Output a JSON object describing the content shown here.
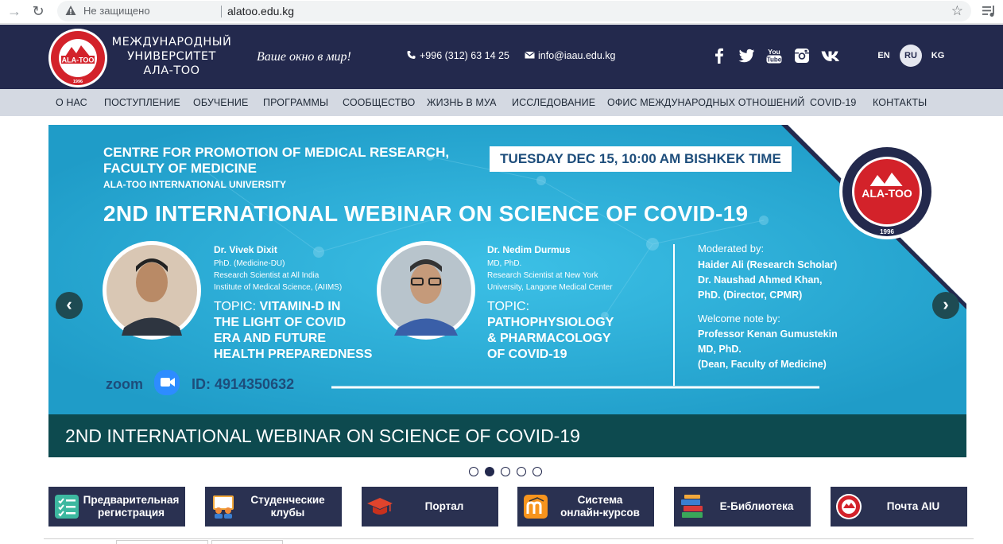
{
  "browser": {
    "security_label": "Не защищено",
    "url": "alatoo.edu.kg"
  },
  "header": {
    "logo_text": "ALA-TOO",
    "logo_ring_text": "ALA-TOO INTERNATIONAL UNIVERSITY",
    "logo_year": "1996",
    "university_name_line1": "МЕЖДУНАРОДНЫЙ",
    "university_name_line2": "УНИВЕРСИТЕТ",
    "university_name_line3": "АЛА-ТОО",
    "slogan": "Ваше окно в мир!",
    "phone": "+996 (312) 63 14 25",
    "email": "info@iaau.edu.kg",
    "social_icons": [
      "facebook-icon",
      "twitter-icon",
      "youtube-icon",
      "instagram-icon",
      "vk-icon"
    ],
    "languages": [
      "EN",
      "RU",
      "KG"
    ],
    "active_language": "RU"
  },
  "nav": {
    "items": [
      "О НАС",
      "ПОСТУПЛЕНИЕ",
      "ОБУЧЕНИЕ",
      "ПРОГРАММЫ",
      "СООБЩЕСТВО",
      "ЖИЗНЬ В МУА",
      "ИССЛЕДОВАНИЕ",
      "ОФИС МЕЖДУНАРОДНЫХ ОТНОШЕНИЙ",
      "COVID-19",
      "КОНТАКТЫ"
    ]
  },
  "slider": {
    "heading_line1": "CENTRE FOR PROMOTION OF MEDICAL RESEARCH,",
    "heading_line2": "FACULTY OF MEDICINE",
    "heading_line3": "ALA-TOO INTERNATIONAL UNIVERSITY",
    "date": "TUESDAY DEC 15, 10:00 AM BISHKEK TIME",
    "title": "2ND INTERNATIONAL WEBINAR ON SCIENCE OF COVID-19",
    "speaker1": {
      "name": "Dr. Vivek Dixit",
      "info_line1": "PhD. (Medicine-DU)",
      "info_line2": "Research Scientist at All India",
      "info_line3": "Institute of Medical Science, (AIIMS)",
      "topic_prefix": "TOPIC: ",
      "topic_line1": "VITAMIN-D IN",
      "topic_line2": "THE LIGHT OF COVID",
      "topic_line3": "ERA AND FUTURE",
      "topic_line4": "HEALTH PREPAREDNESS"
    },
    "speaker2": {
      "name": "Dr. Nedim Durmus",
      "info_line1": "MD, PhD.",
      "info_line2": "Research Scientist at New York",
      "info_line3": "University, Langone Medical Center",
      "topic_prefix": "TOPIC:",
      "topic_line1": "PATHOPHYSIOLOGY",
      "topic_line2": "& PHARMACOLOGY",
      "topic_line3": "OF COVID-19"
    },
    "moderated_label": "Moderated by:",
    "moderator1": "Haider Ali (Research Scholar)",
    "moderator2_line1": "Dr. Naushad Ahmed Khan,",
    "moderator2_line2": "PhD. (Director, CPMR)",
    "welcome_label": "Welcome note by:",
    "welcome_line1": "Professor Kenan Gumustekin",
    "welcome_line2": "MD, PhD.",
    "welcome_line3": "(Dean, Faculty of Medicine)",
    "zoom_label": "zoom",
    "zoom_id": "ID: 4914350632",
    "caption": "2ND INTERNATIONAL WEBINAR ON SCIENCE OF COVID-19",
    "prev_label": "‹",
    "next_label": "›",
    "dot_count": 5,
    "active_dot": 2
  },
  "quick_links": [
    {
      "line1": "Предварительная",
      "line2": "регистрация",
      "icon": "checklist-icon"
    },
    {
      "line1": "Студенческие",
      "line2": "клубы",
      "icon": "students-board-icon"
    },
    {
      "line1": "Портал",
      "line2": "",
      "icon": "graduation-cap-icon"
    },
    {
      "line1": "Система",
      "line2": "онлайн-курсов",
      "icon": "moodle-icon"
    },
    {
      "line1": "Е-Библиотека",
      "line2": "",
      "icon": "books-icon"
    },
    {
      "line1": "Почта AIU",
      "line2": "",
      "icon": "university-seal-icon"
    }
  ],
  "colors": {
    "header_bg": "#23294d",
    "nav_bg": "#d4d9e2",
    "slide_bg": "#28aed6",
    "caption_bg": "#0d4a4f",
    "logo_red": "#d3222a"
  }
}
